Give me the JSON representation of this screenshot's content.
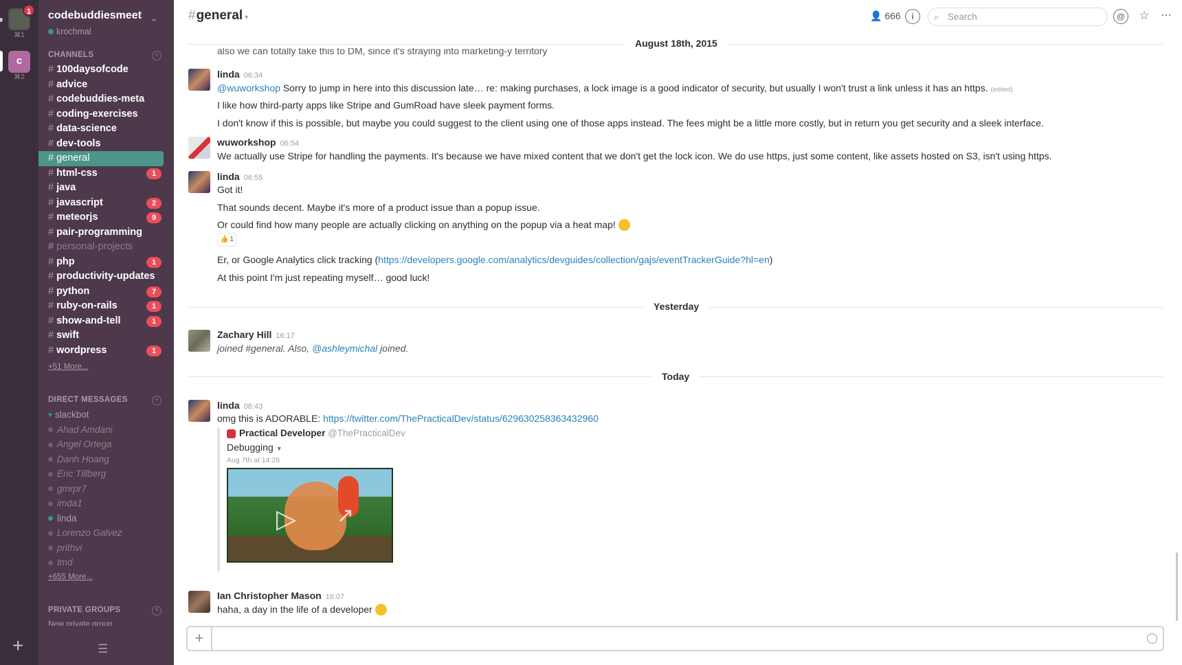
{
  "teams": [
    {
      "key": "⌘1",
      "badge": "1"
    },
    {
      "initial": "c",
      "key": "⌘2"
    }
  ],
  "team": {
    "name": "codebuddiesmeet",
    "user": "krochmal"
  },
  "sidebar": {
    "channels_header": "CHANNELS",
    "channels": [
      {
        "name": "100daysofcode",
        "unread": true
      },
      {
        "name": "advice",
        "unread": true
      },
      {
        "name": "codebuddies-meta",
        "unread": true
      },
      {
        "name": "coding-exercises",
        "unread": true
      },
      {
        "name": "data-science",
        "unread": true
      },
      {
        "name": "dev-tools",
        "unread": true
      },
      {
        "name": "general",
        "active": true
      },
      {
        "name": "html-css",
        "unread": true,
        "badge": "1"
      },
      {
        "name": "java",
        "unread": true
      },
      {
        "name": "javascript",
        "unread": true,
        "badge": "2"
      },
      {
        "name": "meteorjs",
        "unread": true,
        "badge": "9"
      },
      {
        "name": "pair-programming",
        "unread": true
      },
      {
        "name": "personal-projects",
        "muted": true
      },
      {
        "name": "php",
        "unread": true,
        "badge": "1"
      },
      {
        "name": "productivity-updates",
        "unread": true
      },
      {
        "name": "python",
        "unread": true,
        "badge": "7"
      },
      {
        "name": "ruby-on-rails",
        "unread": true,
        "badge": "1"
      },
      {
        "name": "show-and-tell",
        "unread": true,
        "badge": "1"
      },
      {
        "name": "swift",
        "unread": true
      },
      {
        "name": "wordpress",
        "unread": true,
        "badge": "1"
      }
    ],
    "channels_more": "+51 More...",
    "dm_header": "DIRECT MESSAGES",
    "dms": [
      {
        "name": "slackbot",
        "type": "slack"
      },
      {
        "name": "Ahad Amdani"
      },
      {
        "name": "Angel Ortega"
      },
      {
        "name": "Danh Hoang"
      },
      {
        "name": "Eric Tillberg"
      },
      {
        "name": "gmrpr7"
      },
      {
        "name": "imda1"
      },
      {
        "name": "linda",
        "type": "online"
      },
      {
        "name": "Lorenzo Galvez"
      },
      {
        "name": "prithvi"
      },
      {
        "name": "tmd"
      }
    ],
    "dms_more": "+655 More...",
    "groups_header": "PRIVATE GROUPS",
    "groups_sub": "New private group"
  },
  "header": {
    "hash": "#",
    "channel": "general",
    "members": "666",
    "search_placeholder": "Search"
  },
  "days": {
    "aug": "August 18th, 2015",
    "yesterday": "Yesterday",
    "today": "Today"
  },
  "messages": {
    "cutoff": "also we can totally take this to DM, since it's straying into marketing-y territory",
    "m1": {
      "author": "linda",
      "time": "06:34",
      "mention": "@wuworkshop",
      "text1": " Sorry to jump in here into this discussion late… re: making purchases, a lock image is a good indicator of security, but usually I won't trust a link unless it has an https.",
      "edited": "(edited)",
      "text2": "I like how third-party apps like Stripe and GumRoad have sleek payment forms.",
      "text3": "I don't know if this is possible, but maybe you could suggest to the client using one of those apps instead. The fees might be a little more costly, but in return you get security and a sleek interface."
    },
    "m2": {
      "author": "wuworkshop",
      "time": "06:54",
      "text": "We actually use Stripe for handling the payments. It's because we have mixed content that we don't get the lock icon. We do use https, just some content, like assets hosted on S3, isn't using https."
    },
    "m3": {
      "author": "linda",
      "time": "06:55",
      "text1": "Got it!",
      "text2": "That sounds decent. Maybe it's more of a product issue than a popup issue.",
      "text3": "Or could find how many people are actually clicking on anything on the popup via a heat map!",
      "reaction_count": "1",
      "text4_pre": "Er, or Google Analytics click tracking (",
      "text4_link": "https://developers.google.com/analytics/devguides/collection/gajs/eventTrackerGuide?hl=en",
      "text4_post": ")",
      "text5": "At this point I'm just repeating myself… good luck!"
    },
    "m4": {
      "author": "Zachary Hill",
      "time": "16:17",
      "text_pre": "joined #general. Also, ",
      "mention": "@ashleymichal",
      "text_post": " joined."
    },
    "m5": {
      "author": "linda",
      "time": "08:43",
      "text_pre": "omg this is ADORABLE: ",
      "link": "https://twitter.com/ThePracticalDev/status/629630258363432960",
      "att_name": "Practical Developer",
      "att_handle": "@ThePracticalDev",
      "att_text": "Debugging",
      "att_date": "Aug 7th at 14:28"
    },
    "m6": {
      "author": "Ian Christopher Mason",
      "time": "16:07",
      "text": "haha, a day in the life of a developer"
    }
  }
}
